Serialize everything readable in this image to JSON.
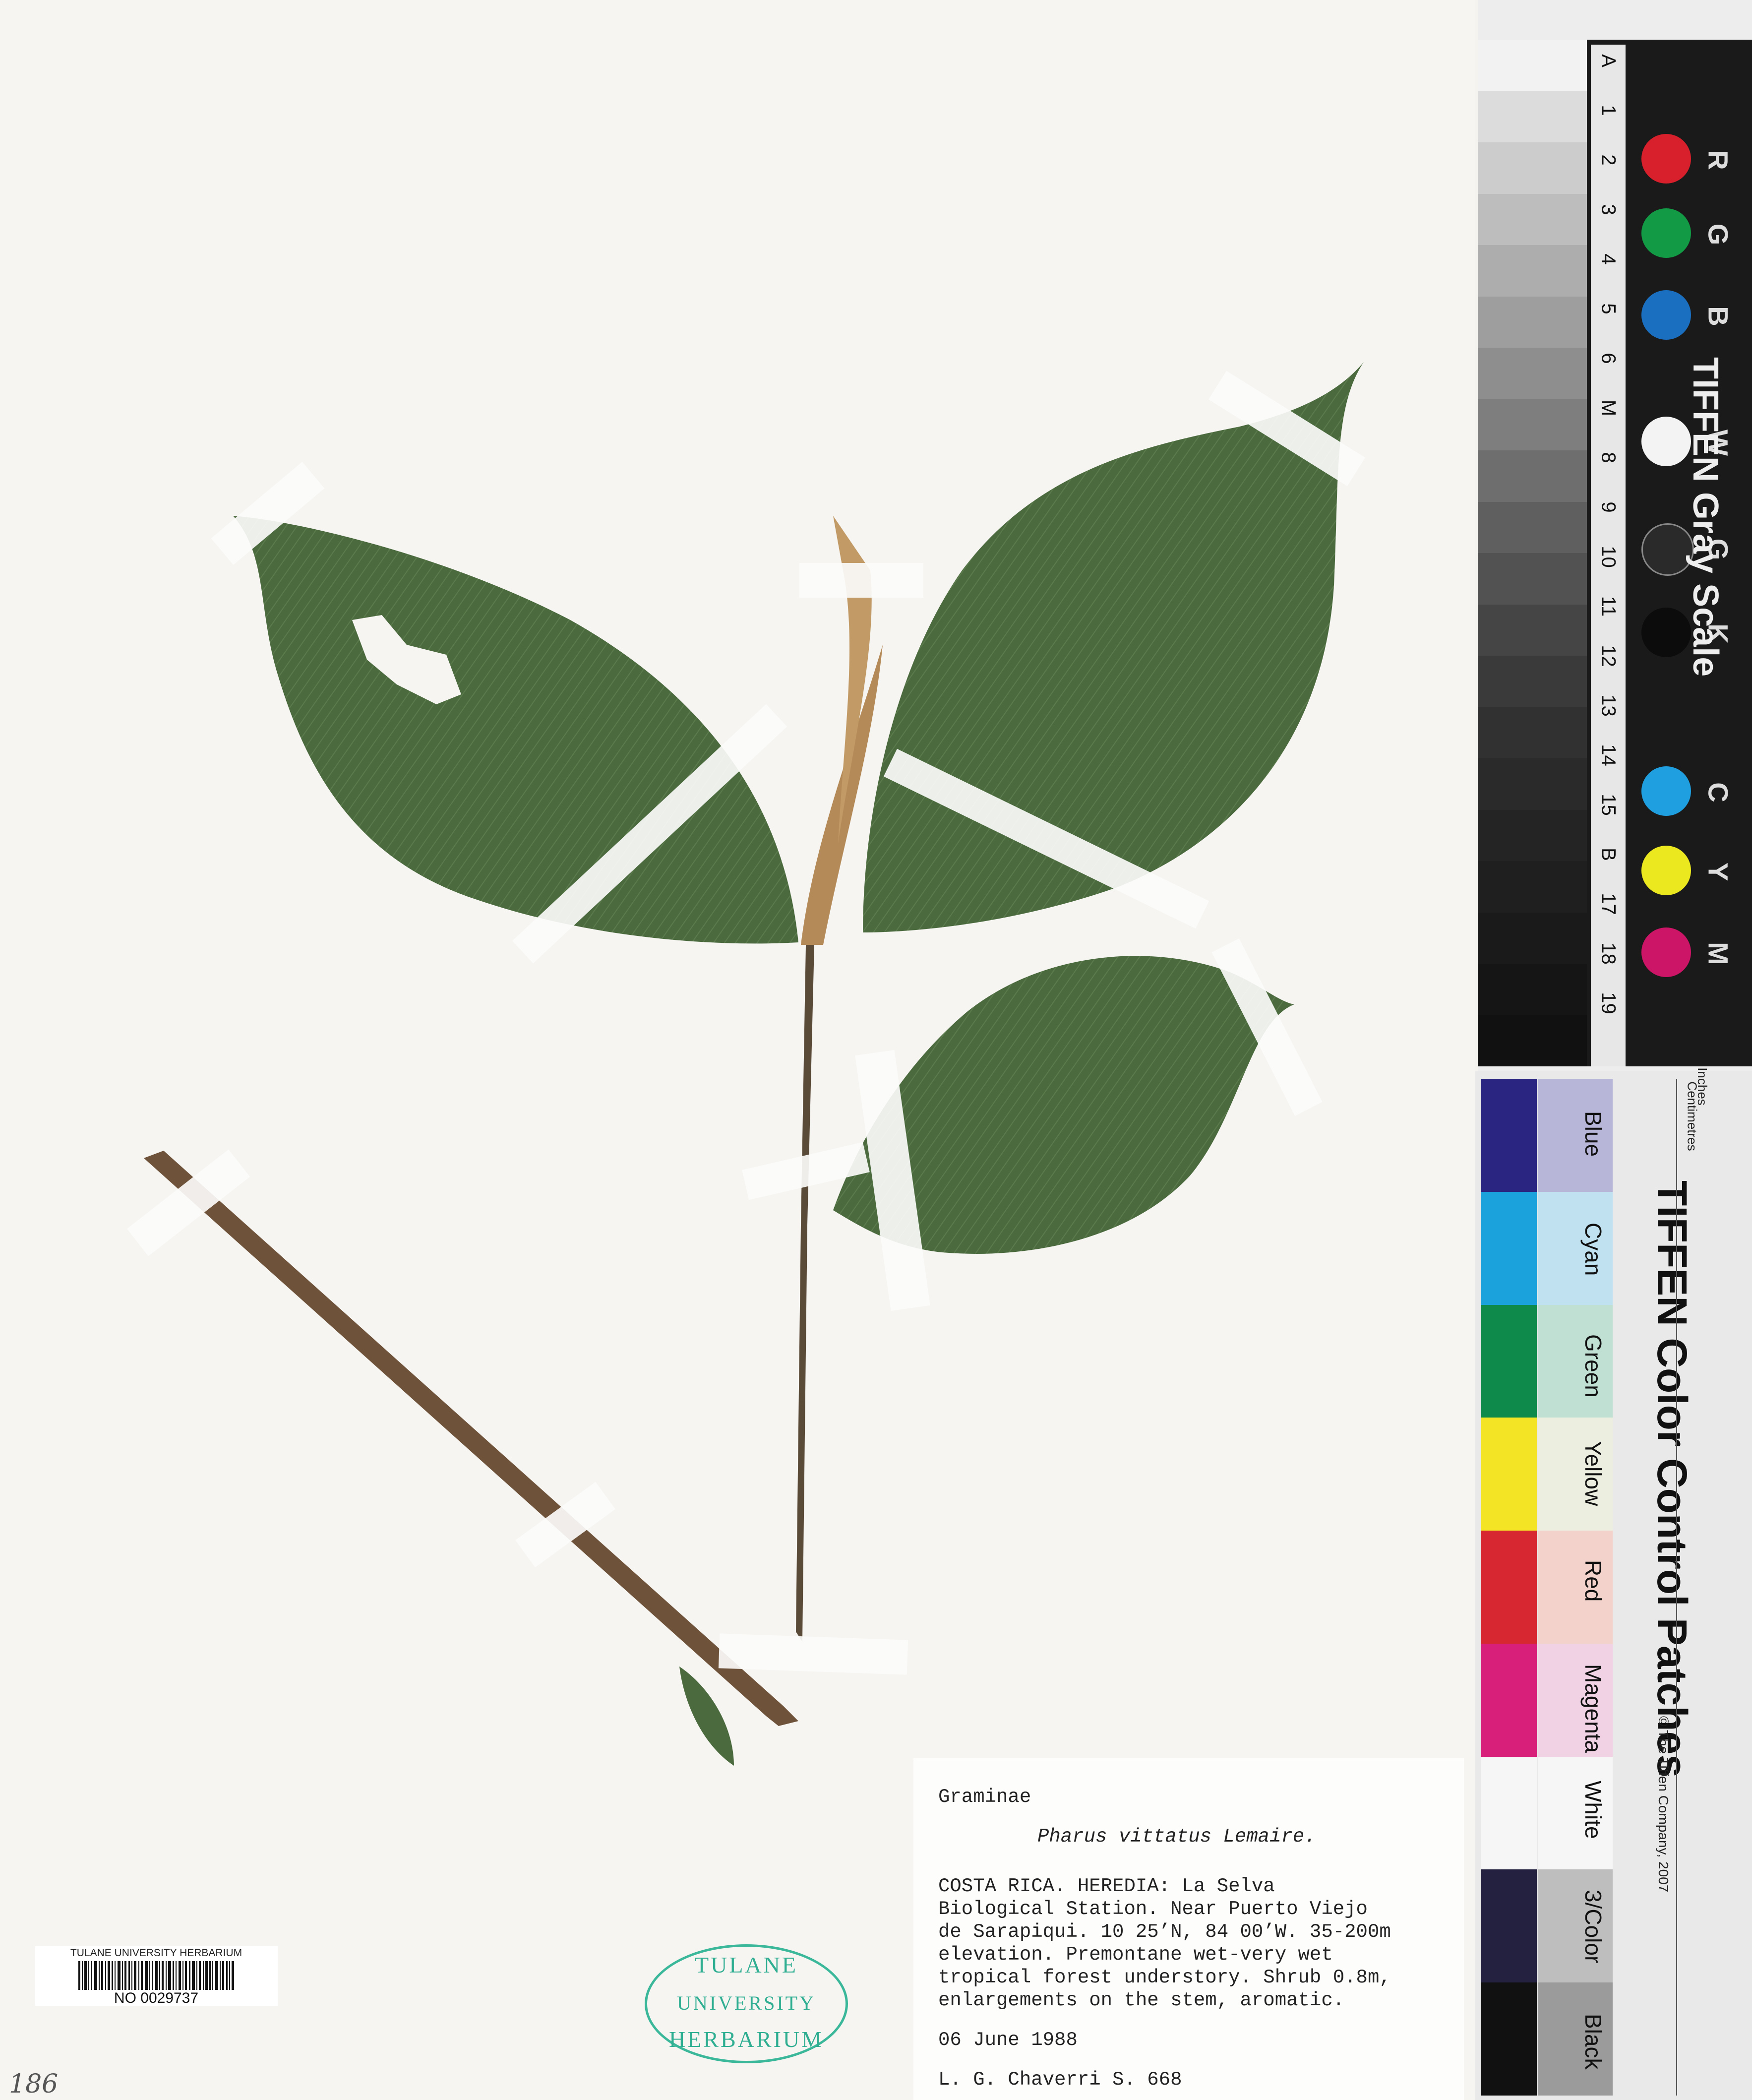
{
  "label": {
    "family": "Graminae",
    "species": "Pharus vittatus Lemaire.",
    "locality_lines": [
      "COSTA RICA. HEREDIA: La Selva",
      "Biological Station. Near Puerto Viejo",
      "de Sarapiqui. 10 25’N, 84 00’W. 35-200m",
      "elevation. Premontane wet-very wet",
      "tropical forest understory. Shrub 0.8m,",
      "enlargements on the stem, aromatic."
    ],
    "date": "06 June 1988",
    "collector": "L. G. Chaverri S. 668"
  },
  "barcode": {
    "institution": "TULANE UNIVERSITY HERBARIUM",
    "number": "NO 0029737"
  },
  "stamp": {
    "line1": "TULANE",
    "line2": "UNIVERSITY",
    "line3": "HERBARIUM"
  },
  "handwritten_note": "186",
  "gray_scale": {
    "brand": "TIFFEN Gray Scale",
    "ruler": [
      "A",
      "1",
      "2",
      "3",
      "4",
      "5",
      "6",
      "M",
      "8",
      "9",
      "10",
      "11",
      "12",
      "13",
      "14",
      "15",
      "B",
      "17",
      "18",
      "19"
    ],
    "dots": [
      {
        "letter": "R",
        "color": "#d7202b"
      },
      {
        "letter": "G",
        "color": "#129a45"
      },
      {
        "letter": "B",
        "color": "#1b6fc0"
      },
      {
        "letter": "W",
        "color": "#f3f3f3"
      },
      {
        "letter": "G",
        "color": "#2a2a2a"
      },
      {
        "letter": "K",
        "color": "#0c0c0c"
      },
      {
        "letter": "C",
        "color": "#1f9fe0"
      },
      {
        "letter": "Y",
        "color": "#ece81f"
      },
      {
        "letter": "M",
        "color": "#cc1566"
      }
    ]
  },
  "color_control": {
    "title": "TIFFEN Color Control Patches",
    "copyright": "© The Tiffen Company, 2007",
    "ruler_units": [
      "Inches",
      "Centimetres"
    ],
    "patches": [
      {
        "name": "Blue",
        "color": "#2b2582",
        "tint": "#b7b5d8"
      },
      {
        "name": "Cyan",
        "color": "#1ba1db",
        "tint": "#bfe1f0"
      },
      {
        "name": "Green",
        "color": "#0e8a4a",
        "tint": "#bfe0d3"
      },
      {
        "name": "Yellow",
        "color": "#f4e426",
        "tint": "#eceee0"
      },
      {
        "name": "Red",
        "color": "#d72730",
        "tint": "#f2d2ca"
      },
      {
        "name": "Magenta",
        "color": "#d8207a",
        "tint": "#f0d2e4"
      },
      {
        "name": "White",
        "color": "#f6f6f6",
        "tint": "#f6f6f6"
      },
      {
        "name": "3/Color",
        "color": "#24203f",
        "tint": "#bebebe"
      },
      {
        "name": "Black",
        "color": "#111111",
        "tint": "#9b9b9b"
      }
    ]
  }
}
